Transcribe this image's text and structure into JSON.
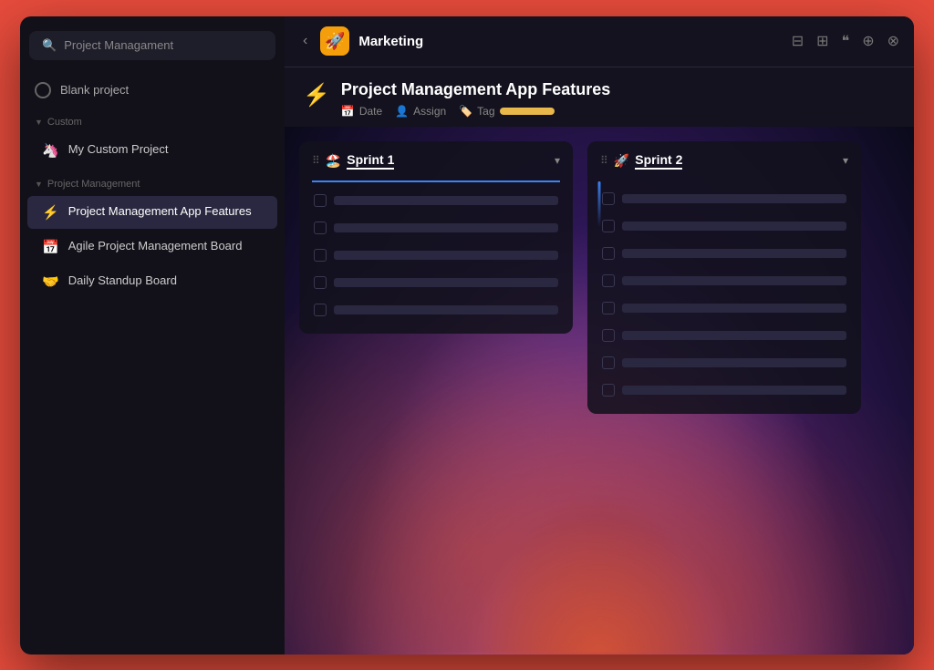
{
  "sidebar": {
    "search_placeholder": "Project Managament",
    "blank_project_label": "Blank project",
    "sections": [
      {
        "label": "Custom",
        "items": [
          {
            "id": "my-custom-project",
            "icon": "🦄",
            "label": "My Custom Project",
            "active": false
          }
        ]
      },
      {
        "label": "Project Management",
        "items": [
          {
            "id": "pm-app-features",
            "icon": "⚡",
            "label": "Project Management App Features",
            "active": true
          },
          {
            "id": "agile-board",
            "icon": "📅",
            "label": "Agile Project Management Board",
            "active": false
          },
          {
            "id": "standup-board",
            "icon": "🤝",
            "label": "Daily Standup Board",
            "active": false
          }
        ]
      }
    ]
  },
  "topbar": {
    "back_label": "‹",
    "workspace_icon": "🚀",
    "workspace_name": "Marketing",
    "actions": [
      "⊟",
      "⊞",
      "⋯",
      "⊕",
      "⊗"
    ]
  },
  "page": {
    "icon": "⚡",
    "title": "Project Management App Features",
    "meta": {
      "date_label": "Date",
      "assign_label": "Assign",
      "tag_label": "Tag"
    }
  },
  "board": {
    "columns": [
      {
        "id": "sprint-1",
        "icon": "🏖️",
        "title": "Sprint 1",
        "has_focus_bar": true,
        "task_count": 5
      },
      {
        "id": "sprint-2",
        "icon": "🚀",
        "title": "Sprint 2",
        "has_focus_bar": false,
        "task_count": 8
      }
    ]
  }
}
